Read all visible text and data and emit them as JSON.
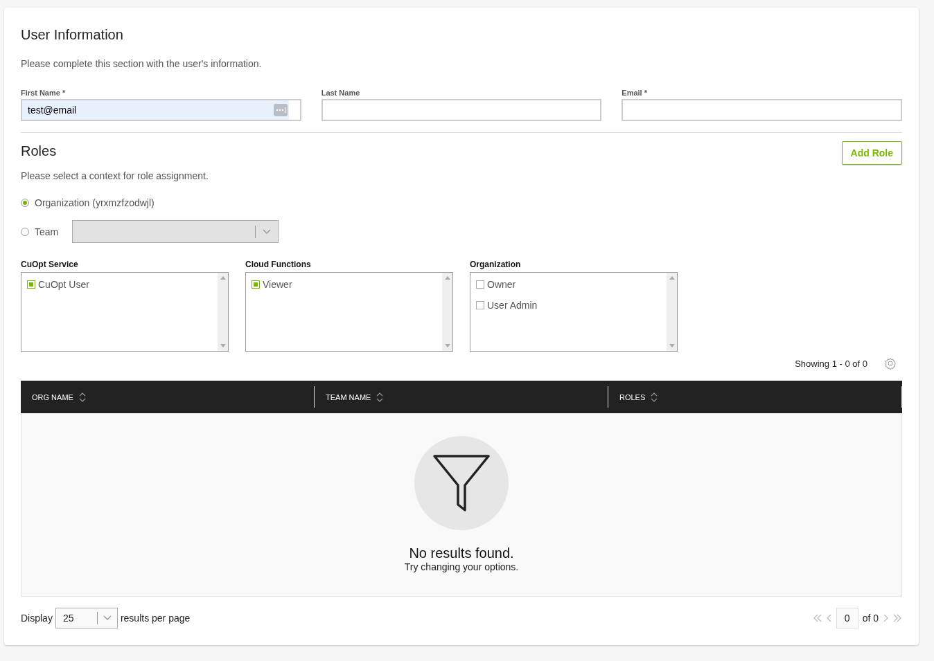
{
  "user_info": {
    "title": "User Information",
    "description": "Please complete this section with the user's information.",
    "fields": [
      {
        "label": "First Name *",
        "value": "test@email",
        "autofilled": true
      },
      {
        "label": "Last Name",
        "autofilled": false
      },
      {
        "label": "Email *",
        "autofilled": false
      }
    ]
  },
  "roles": {
    "title": "Roles",
    "add_button": "Add Role",
    "description": "Please select a context for role assignment.",
    "contexts": [
      {
        "label": "Organization (yrxmzfzodwjl)",
        "selected": true,
        "kind": "plain"
      },
      {
        "label": "Team",
        "selected": false,
        "kind": "dropdown",
        "disabled": true
      }
    ],
    "groups": [
      {
        "title": "CuOpt Service",
        "options": [
          {
            "label": "CuOpt User",
            "checked": true
          }
        ]
      },
      {
        "title": "Cloud Functions",
        "options": [
          {
            "label": "Viewer",
            "checked": true
          }
        ]
      },
      {
        "title": "Organization",
        "options": [
          {
            "label": "Owner",
            "checked": false
          },
          {
            "label": "User Admin",
            "checked": false
          }
        ]
      }
    ]
  },
  "table": {
    "showing": "Showing 1 - 0 of 0",
    "columns": [
      "ORG NAME",
      "TEAM NAME",
      "ROLES"
    ],
    "empty_title": "No results found.",
    "empty_subtitle": "Try changing your options."
  },
  "footer": {
    "display_label": "Display",
    "page_size": "25",
    "per_page_label": "results per page",
    "page": "0",
    "of_pages": "of 0"
  }
}
